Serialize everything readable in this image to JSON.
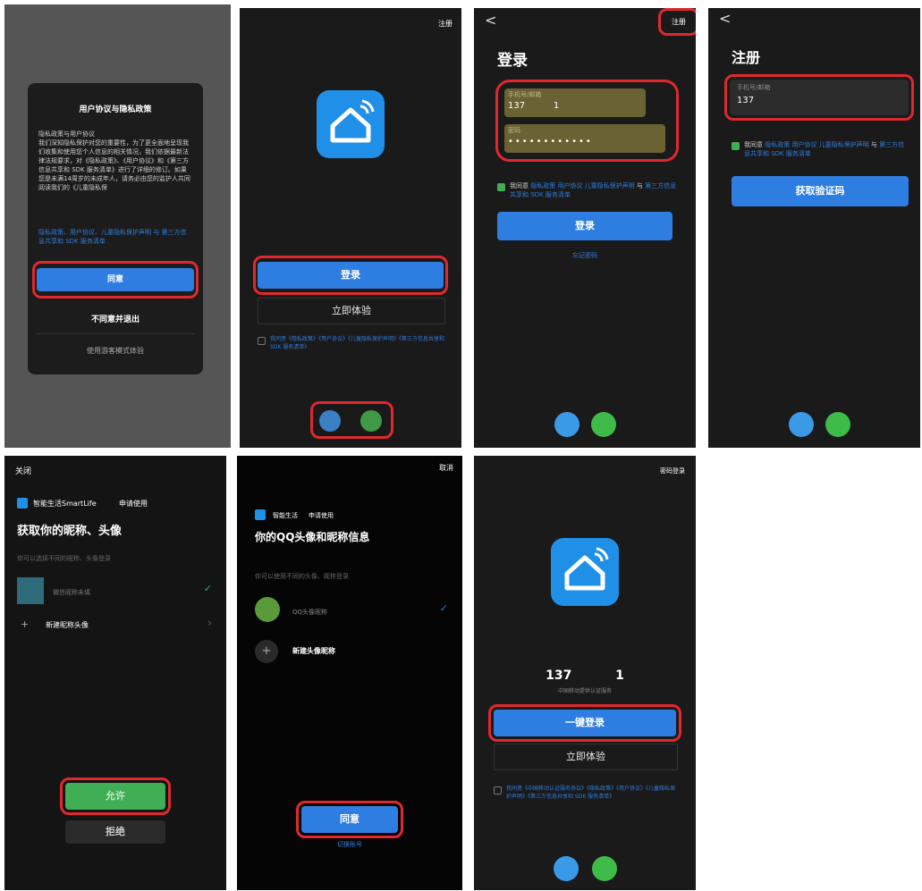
{
  "colors": {
    "panel_bg": "#1a1a1a",
    "accent_blue": "#2e7de0",
    "highlight_red": "#e0282e",
    "agree_green": "#3fae55",
    "qq_blue": "#3b9ae8",
    "wechat_green": "#3fbb4a"
  },
  "screen1": {
    "title": "用户协议与隐私政策",
    "subtitle": "隐私政策与用户协议",
    "body": "我们深知隐私保护对您的重要性，为了更全面地呈现我们收集和使用您个人信息的相关情况，我们依据最新法律法规要求，对《隐私政策》、《用户协议》和《第三方信息共享和 SDK 服务清单》进行了详细的修订。如果您是未满14周岁的未成年人，请务必由您的监护人共同阅读我们的《儿童隐私保",
    "links": "隐私政策、用户协议、儿童隐私保护声明 与 第三方信息共享和 SDK 服务清单",
    "agree": "同意",
    "disagree": "不同意并退出",
    "guest": "使用游客模式体验"
  },
  "screen2": {
    "register": "注册",
    "login": "登录",
    "try_now": "立即体验",
    "agreement": "我同意《隐私政策》《用户协议》《儿童隐私保护声明》《第三方信息共享和 SDK 服务清单》"
  },
  "screen3": {
    "back": "<",
    "register": "注册",
    "title": "登录",
    "account_label": "手机号/邮箱",
    "account_value": "137          1",
    "password_label": "密码",
    "password_value": "••••••••••••",
    "agreement_prefix": "我同意",
    "agreement_links": "隐私政策 用户协议 儿童隐私保护声明",
    "agreement_and": "与",
    "agreement_links2": "第三方信息共享和 SDK 服务清单",
    "login": "登录",
    "forgot": "忘记密码"
  },
  "screen4": {
    "back": "<",
    "title": "注册",
    "field_label": "手机号/邮箱",
    "field_value": "137",
    "agreement_prefix": "我同意",
    "agreement_links": "隐私政策 用户协议 儿童隐私保护声明",
    "agreement_and": "与",
    "agreement_links2": "第三方信息共享和 SDK 服务清单",
    "get_code": "获取验证码"
  },
  "screen5": {
    "close": "关闭",
    "app_name": "智能生活SmartLife",
    "apply": "申请使用",
    "title": "获取你的昵称、头像",
    "hint": "你可以选择不同的昵称、头像登录",
    "profile_name": "微信昵称未填",
    "new_profile": "新建昵称头像",
    "allow": "允许",
    "reject": "拒绝"
  },
  "screen6": {
    "cancel": "取消",
    "app_name": "智能生活",
    "apply": "申请使用",
    "title": "你的QQ头像和昵称信息",
    "hint": "你可以使用不同的头像、昵称登录",
    "profile_name": "QQ头像昵称",
    "new_profile": "新建头像昵称",
    "agree": "同意",
    "switch_account": "切换账号"
  },
  "screen7": {
    "password_login": "密码登录",
    "phone": "137          1",
    "carrier_note": "中国移动提供认证服务",
    "one_click": "一键登录",
    "try_now": "立即体验",
    "agreement": "我同意《中国移动认证服务协议》《隐私政策》《用户协议》《儿童隐私保护声明》《第三方信息共享和 SDK 服务清单》"
  }
}
